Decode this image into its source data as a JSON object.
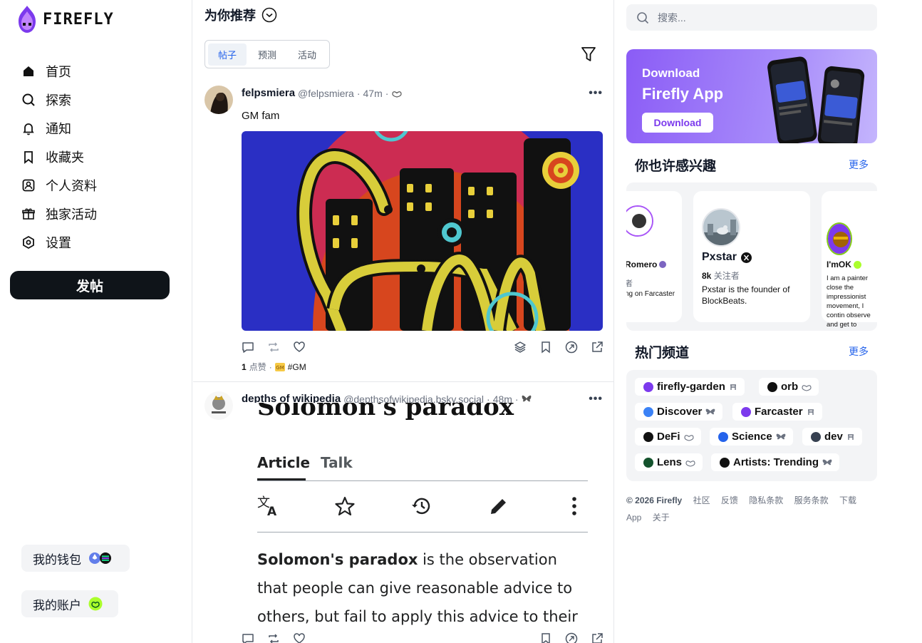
{
  "brand": {
    "name": "FIREFLY"
  },
  "nav": [
    {
      "id": "home",
      "label": "首页",
      "icon": "home-icon"
    },
    {
      "id": "explore",
      "label": "探索",
      "icon": "search-icon"
    },
    {
      "id": "notifications",
      "label": "通知",
      "icon": "bell-icon"
    },
    {
      "id": "bookmarks",
      "label": "收藏夹",
      "icon": "bookmark-icon"
    },
    {
      "id": "profile",
      "label": "个人资料",
      "icon": "profile-icon"
    },
    {
      "id": "events",
      "label": "独家活动",
      "icon": "gift-icon"
    },
    {
      "id": "settings",
      "label": "设置",
      "icon": "settings-icon"
    }
  ],
  "post_button": "发帖",
  "wallet_label": "我的钱包",
  "account_label": "我的账户",
  "feed": {
    "title": "为你推荐",
    "tabs": [
      {
        "label": "帖子",
        "active": true
      },
      {
        "label": "预测",
        "active": false
      },
      {
        "label": "活动",
        "active": false
      }
    ],
    "posts": [
      {
        "name": "felpsmiera",
        "handle": "@felpsmiera",
        "time": "47m",
        "text": "GM fam",
        "likes_count": "1",
        "likes_label": "点赞",
        "tag": "#GM"
      },
      {
        "name": "depths of wikipedia",
        "handle": "@depthsofwikipedia.bsky.social",
        "time": "48m",
        "wiki": {
          "title_partial": "Solomon's paradox",
          "tab_article": "Article",
          "tab_talk": "Talk",
          "body_bold": "Solomon's paradox",
          "body_rest": " is the observation that people can give reasonable advice to others, but fail to apply this advice to their"
        }
      }
    ]
  },
  "search": {
    "placeholder": "搜索..."
  },
  "banner": {
    "line1": "Download",
    "line2": "Firefly App",
    "button": "Download"
  },
  "suggest": {
    "title": "你也许感兴趣",
    "more": "更多",
    "left_partial": {
      "name": "Romero",
      "followers": "者",
      "bio": "ng on Farcaster"
    },
    "main": {
      "name": "Pxstar",
      "followers_count": "8k",
      "followers_label": "关注者",
      "bio": "Pxstar is the founder of BlockBeats."
    },
    "right_partial": {
      "name": "I'mOK",
      "bio": "I am a painter close the impressionist movement, I contin observe and get to"
    }
  },
  "channels": {
    "title": "热门频道",
    "more": "更多",
    "items": [
      {
        "label": "firefly-garden",
        "color": "#7c3aed"
      },
      {
        "label": "orb",
        "color": "#111111"
      },
      {
        "label": "Discover",
        "color": "#3b82f6"
      },
      {
        "label": "Farcaster",
        "color": "#7c3aed"
      },
      {
        "label": "DeFi",
        "color": "#111111"
      },
      {
        "label": "Science",
        "color": "#2563eb"
      },
      {
        "label": "dev",
        "color": "#374151"
      },
      {
        "label": "Lens",
        "color": "#14532d"
      },
      {
        "label": "Artists: Trending",
        "color": "#111111"
      }
    ]
  },
  "footer": {
    "copyright": "© 2026 Firefly",
    "links": [
      "社区",
      "反馈",
      "隐私条款",
      "服务条款",
      "下载 App",
      "关于"
    ]
  }
}
